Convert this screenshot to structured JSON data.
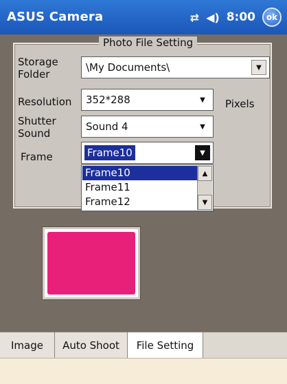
{
  "app": {
    "title": "ASUS Camera",
    "status": {
      "time": "8:00",
      "ok_label": "ok",
      "icons": [
        "connectivity-icon",
        "volume-icon"
      ]
    }
  },
  "settings": {
    "group_title": "Photo File Setting",
    "storage_folder": {
      "label_line1": "Storage",
      "label_line2": "Folder",
      "value": "\\My Documents\\"
    },
    "resolution": {
      "label": "Resolution",
      "value": "352*288",
      "unit": "Pixels"
    },
    "shutter_sound": {
      "label_line1": "Shutter",
      "label_line2": "Sound",
      "value": "Sound 4"
    },
    "frame": {
      "label": "Frame",
      "value": "Frame10",
      "options": [
        "Frame10",
        "Frame11",
        "Frame12"
      ]
    }
  },
  "preview": {
    "frame_color": "#e8207a",
    "border_color": "#d3cbc3"
  },
  "tabs": [
    {
      "label": "Image"
    },
    {
      "label": "Auto Shoot"
    },
    {
      "label": "File Setting"
    }
  ],
  "colors": {
    "titlebar": "#1b56b8",
    "selection": "#1c2f9d"
  }
}
